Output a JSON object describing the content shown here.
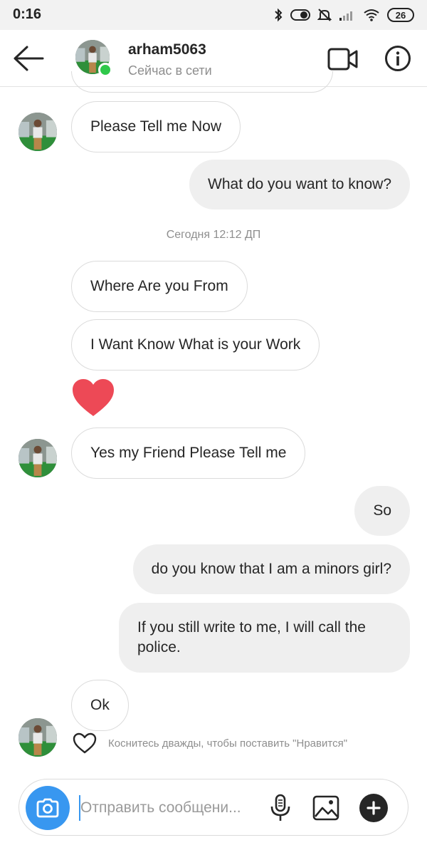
{
  "status_bar": {
    "time": "0:16",
    "battery": "26",
    "icons": [
      "bluetooth-icon",
      "toggle-icon",
      "mute-icon",
      "signal-icon",
      "wifi-icon",
      "battery-icon"
    ]
  },
  "header": {
    "username": "arham5063",
    "online_status": "Сейчас в сети",
    "online_color": "#2fc84a"
  },
  "messages": {
    "m1": "Please Tell me Now",
    "m2": "What do you want to know?",
    "timestamp": "Сегодня 12:12 ДП",
    "m3": "Where Are you From",
    "m4": "I Want Know What is your Work",
    "m5": "Yes my Friend Please Tell me",
    "m6": "So",
    "m7": "do you know that I am a minors girl?",
    "m8": "If you still write to me, I will call the police.",
    "m9": "Ok"
  },
  "like_hint": "Коснитесь дважды, чтобы поставить \"Нравится\"",
  "composer": {
    "placeholder": "Отправить сообщени..."
  },
  "colors": {
    "accent": "#3897f0",
    "heart": "#ed4956",
    "outgoing_bubble": "#efefef"
  }
}
